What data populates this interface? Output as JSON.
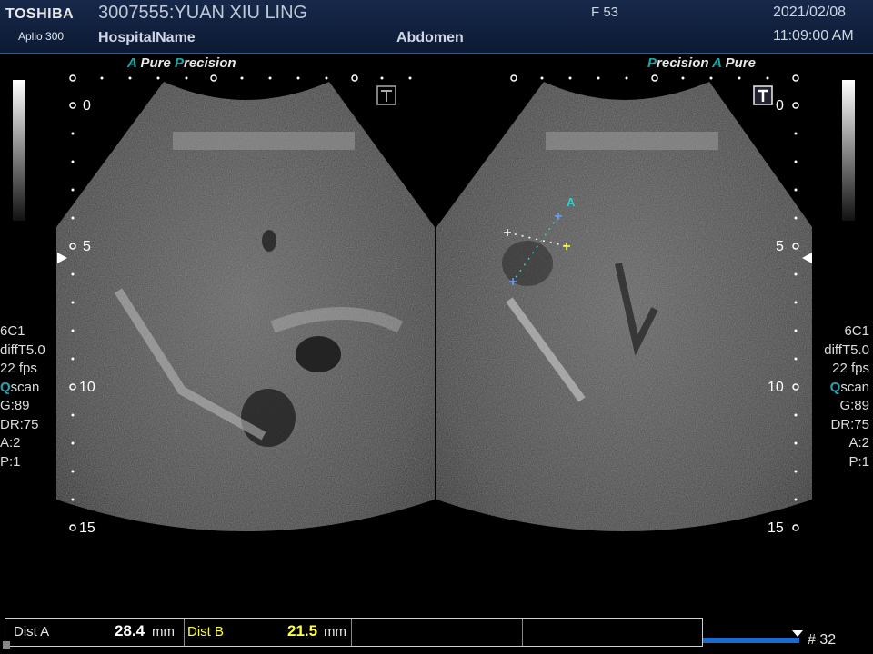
{
  "header": {
    "brand": "TOSHIBA",
    "model": "Aplio 300",
    "patient": "3007555:YUAN XIU LING",
    "hospital": "HospitalName",
    "sex_age": "F  53",
    "exam": "Abdomen",
    "date": "2021/02/08",
    "time": "11:09:00 AM"
  },
  "left_image": {
    "tag1_a": "A",
    "tag1_b": "Pure",
    "tag1_c": "P",
    "tag1_d": "recision",
    "depth_marks": [
      "0",
      "5",
      "10",
      "15"
    ],
    "settings": [
      "6C1",
      "diffT5.0",
      "22 fps",
      "Q",
      "scan",
      "G:89",
      "DR:75",
      "A:2",
      "P:1"
    ]
  },
  "right_image": {
    "tag1_a": "P",
    "tag1_b": "recision",
    "tag1_c": "A",
    "tag1_d": "Pure",
    "depth_marks": [
      "0",
      "5",
      "10",
      "15"
    ],
    "settings": [
      "6C1",
      "diffT5.0",
      "22 fps",
      "Q",
      "scan",
      "G:89",
      "DR:75",
      "A:2",
      "P:1"
    ],
    "caliper_label": "A"
  },
  "measurements": {
    "a_label": "Dist A",
    "a_value": "28.4",
    "a_unit": "mm",
    "b_label": "Dist B",
    "b_value": "21.5",
    "b_unit": "mm"
  },
  "frame_counter": "# 32",
  "colors": {
    "header": "#17284a",
    "accent": "#1fa8a8",
    "caliper": "#ffff40"
  }
}
